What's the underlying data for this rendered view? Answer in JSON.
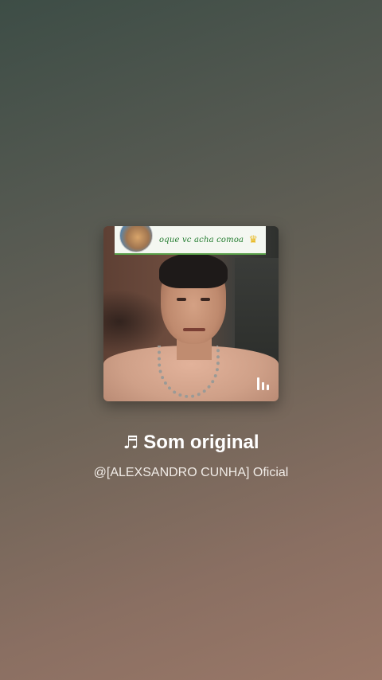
{
  "cover": {
    "banner_text": "oque vc acha comoa",
    "crown_icon": "crown-icon",
    "playing_icon": "audio-bars-icon"
  },
  "sound": {
    "note_icon": "♬",
    "title": "Som original",
    "author": "@[ALEXSANDRO CUNHA] Oficial"
  }
}
